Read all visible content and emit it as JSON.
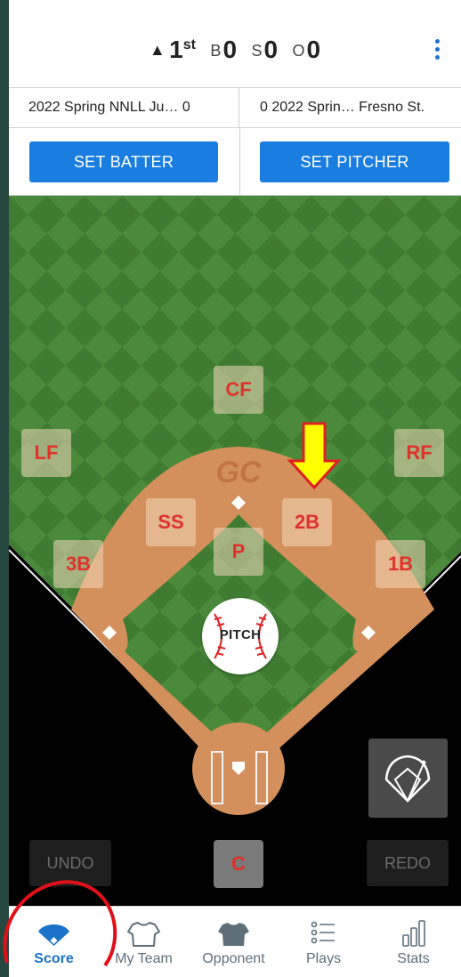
{
  "scoreboard": {
    "half_indicator": "▲",
    "inning": "1",
    "inning_suffix": "st",
    "balls_label": "B",
    "balls": "0",
    "strikes_label": "S",
    "strikes": "0",
    "outs_label": "O",
    "outs": "0"
  },
  "teams": {
    "away": "2022 Spring NNLL Ju… 0",
    "home": "0 2022 Sprin… Fresno St."
  },
  "actions": {
    "set_batter": "SET BATTER",
    "set_pitcher": "SET PITCHER"
  },
  "field": {
    "watermark": "GC",
    "positions": {
      "cf": "CF",
      "lf": "LF",
      "rf": "RF",
      "ss": "SS",
      "second": "2B",
      "pitcher": "P",
      "third": "3B",
      "first": "1B",
      "catcher": "C"
    },
    "pitch_label": "PITCH",
    "undo": "UNDO",
    "redo": "REDO"
  },
  "nav": {
    "items": [
      {
        "label": "Score",
        "active": true
      },
      {
        "label": "My Team"
      },
      {
        "label": "Opponent"
      },
      {
        "label": "Plays"
      },
      {
        "label": "Stats"
      }
    ]
  },
  "colors": {
    "accent": "#1a7ee0",
    "grass_light": "#4c8c3c",
    "grass_dark": "#3e7a30",
    "infield_dirt": "#d4905c",
    "position_text": "#e0312b",
    "highlight_arrow": "#ffff00",
    "annotation_circle": "#e0101a"
  }
}
